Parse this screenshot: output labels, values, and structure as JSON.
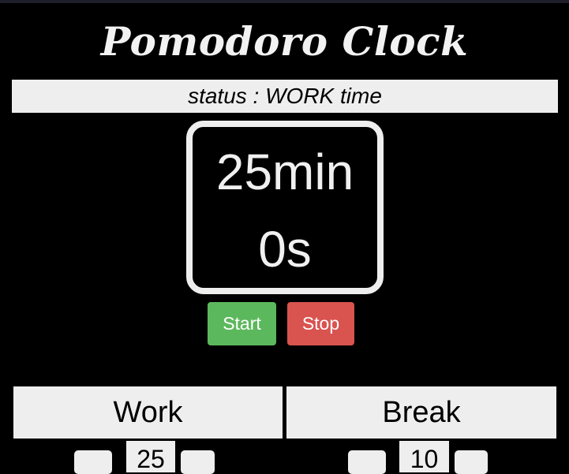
{
  "app": {
    "title": "Pomodoro Clock"
  },
  "status": {
    "text": "status : WORK time"
  },
  "timer": {
    "minutes": "25min",
    "seconds": "0s"
  },
  "controls": {
    "start_label": "Start",
    "stop_label": "Stop"
  },
  "work": {
    "label": "Work",
    "value": "25"
  },
  "break": {
    "label": "Break",
    "value": "10"
  },
  "colors": {
    "background": "#000000",
    "panel": "#eeeeee",
    "start": "#5cb85c",
    "stop": "#d9534f"
  }
}
